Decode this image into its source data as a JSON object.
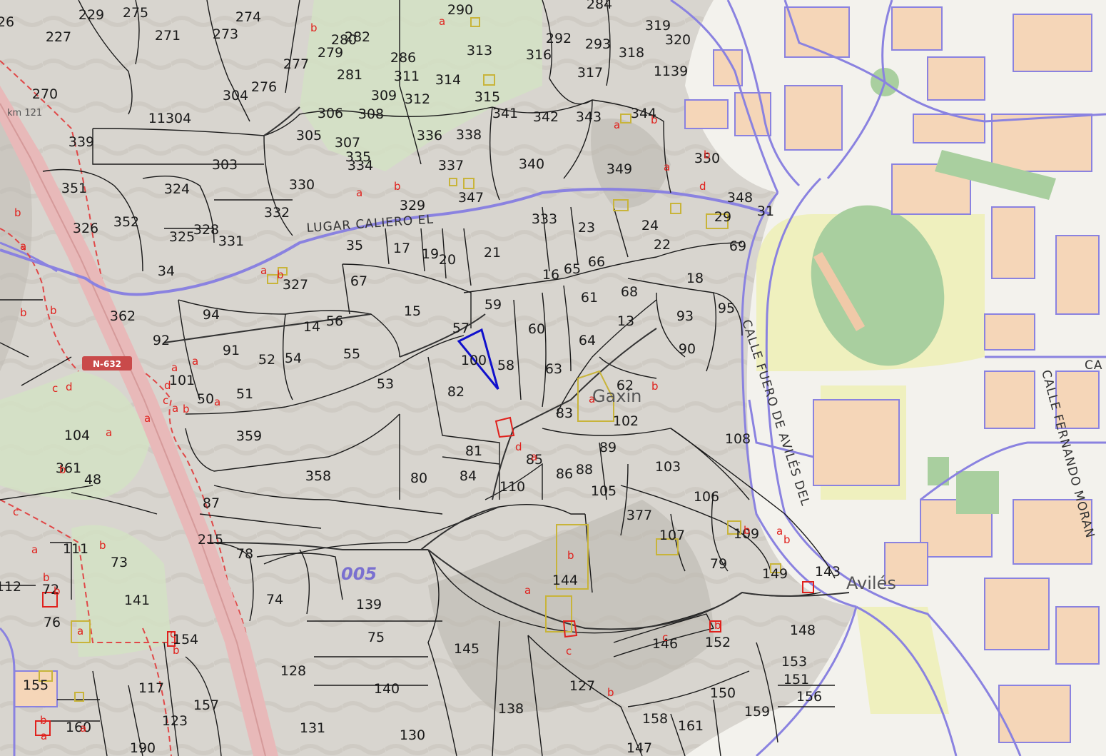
{
  "colors": {
    "terrain": "#d8d5cf",
    "terrain_dark": "#c7c3bc",
    "green_area": "#d3e2c4",
    "urban_bg": "#f3f2ed",
    "building": "#f5d6b8",
    "urban_line": "#8a82e0",
    "parcel_line": "#1a1a1a",
    "municipal_line": "#e04848",
    "highway": "#e8b9b9",
    "selected_parcel": "#1010cc",
    "sports_field": "#a9cf9f",
    "yellow_area": "#eef0b8",
    "structure_yellow": "#c8b43a"
  },
  "labels": {
    "zone": "005",
    "place_aviles": "Avilés",
    "place_gaxin": "Gaxín",
    "street_lugar": "LUGAR CALIERO EL",
    "street_calle_fuero": "CALLE FUERO DE AVILÉS DEL",
    "street_calle_fernando": "CALLE FERNANDO MORAN",
    "street_calle_partial": "CA",
    "road_shield": "N-632",
    "km_marker": "km 121"
  },
  "parcels": [
    "229",
    "275",
    "290",
    "26",
    "227",
    "271",
    "273",
    "274",
    "313",
    "292",
    "293",
    "318",
    "319",
    "320",
    "279",
    "280",
    "282",
    "286",
    "277",
    "281",
    "311",
    "316",
    "317",
    "1139",
    "270",
    "276",
    "304",
    "314",
    "315",
    "312",
    "309",
    "306",
    "308",
    "341",
    "342",
    "343",
    "344",
    "11304",
    "305",
    "307",
    "335",
    "336",
    "338",
    "339",
    "303",
    "330",
    "334",
    "337",
    "340",
    "349",
    "350",
    "351",
    "324",
    "329",
    "347",
    "348",
    "352",
    "326",
    "325",
    "328",
    "331",
    "332",
    "333",
    "23",
    "24",
    "29",
    "31",
    "35",
    "17",
    "19",
    "20",
    "21",
    "22",
    "69",
    "34",
    "327",
    "16",
    "65",
    "66",
    "67",
    "18",
    "94",
    "15",
    "59",
    "61",
    "68",
    "93",
    "95",
    "362",
    "13",
    "92",
    "14",
    "56",
    "57",
    "60",
    "64",
    "91",
    "52",
    "54",
    "55",
    "58",
    "63",
    "90",
    "100",
    "62",
    "101",
    "50",
    "51",
    "53",
    "82",
    "83",
    "102",
    "104",
    "359",
    "81",
    "85",
    "89",
    "103",
    "108",
    "361",
    "48",
    "358",
    "80",
    "84",
    "86",
    "88",
    "105",
    "106",
    "110",
    "87",
    "377",
    "107",
    "109",
    "111",
    "73",
    "215",
    "78",
    "79",
    "112",
    "72",
    "74",
    "139",
    "144",
    "149",
    "141",
    "76",
    "75",
    "145",
    "148",
    "154",
    "128",
    "140",
    "146",
    "152",
    "153",
    "155",
    "117",
    "127",
    "151",
    "156",
    "157",
    "138",
    "150",
    "159",
    "158",
    "161",
    "160",
    "123",
    "130",
    "147",
    "190",
    "131",
    "143",
    "284"
  ],
  "sub_letters": [
    "a",
    "b",
    "c",
    "d"
  ]
}
